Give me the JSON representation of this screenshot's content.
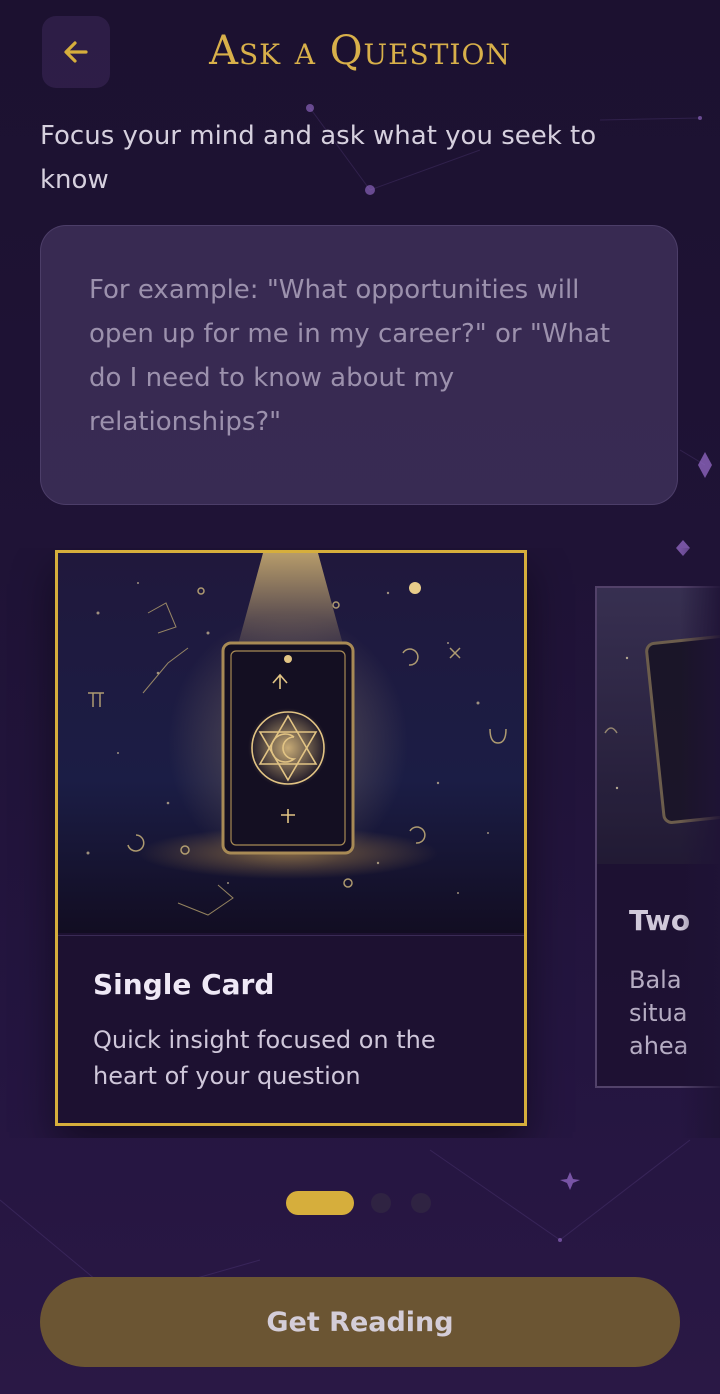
{
  "header": {
    "title": "Ask a Question",
    "back_icon": "arrow-left-icon"
  },
  "prompt": "Focus your mind and ask what you seek to know",
  "question_input": {
    "value": "",
    "placeholder": "For example: \"What opportunities will open up for me in my career?\" or \"What do I need to know about my relationships?\""
  },
  "spreads": [
    {
      "title": "Single Card",
      "description": "Quick insight focused on the heart of your question",
      "selected": true
    },
    {
      "title": "Two",
      "description": "Bala\nsitua\nahea",
      "selected": false
    }
  ],
  "pagination": {
    "count": 3,
    "active": 0
  },
  "cta": {
    "label": "Get Reading"
  },
  "colors": {
    "accent_gold": "#d6ae3c",
    "background": "#1f1336",
    "input_bg": "#483a66",
    "cta_bg": "#6b5533"
  }
}
